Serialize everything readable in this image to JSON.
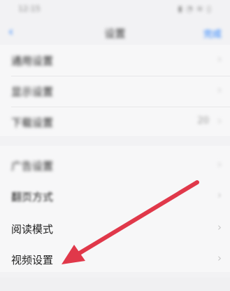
{
  "status": {
    "time": "12:15",
    "icons": "▮ ◔ ≋ ▯"
  },
  "nav": {
    "back_icon": "‹",
    "title": "设置",
    "action": "完成"
  },
  "groups": [
    {
      "rows": [
        {
          "label": "通用设置"
        },
        {
          "label": "显示设置"
        },
        {
          "label": "下载设置",
          "value": "20"
        }
      ]
    },
    {
      "rows": [
        {
          "label": "广告设置"
        },
        {
          "label": "翻页方式"
        },
        {
          "label": "阅读模式"
        },
        {
          "label": "视频设置"
        }
      ]
    }
  ],
  "icons": {
    "chevron": "chevron-right-icon",
    "back": "back-arrow-icon"
  },
  "colors": {
    "accent": "#1e7cff",
    "annotation_arrow": "#e0384a"
  }
}
